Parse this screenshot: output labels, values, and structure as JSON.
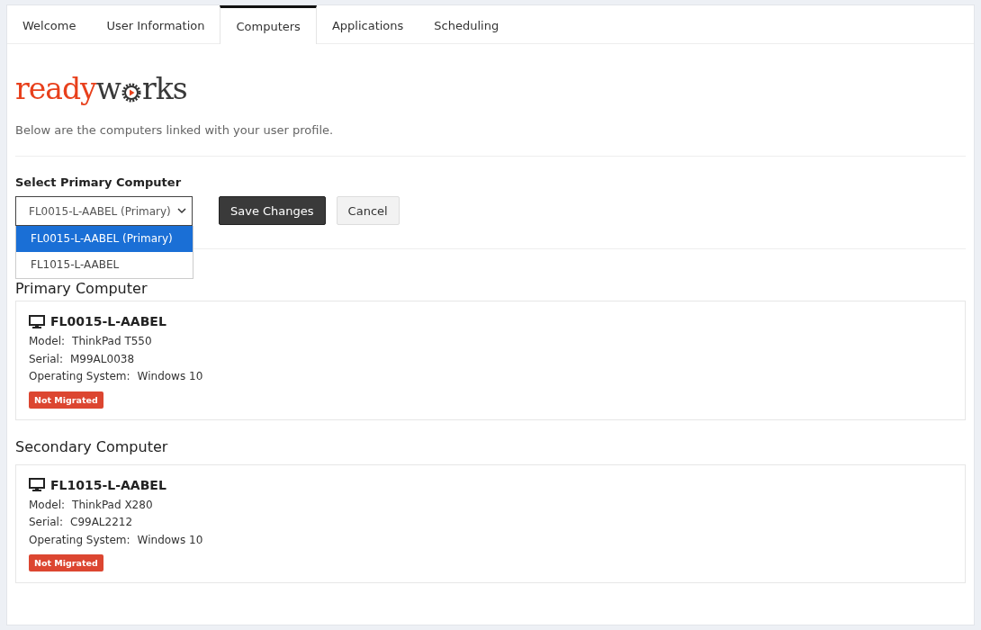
{
  "tabs": [
    {
      "label": "Welcome",
      "selected": false
    },
    {
      "label": "User Information",
      "selected": false
    },
    {
      "label": "Computers",
      "selected": true
    },
    {
      "label": "Applications",
      "selected": false
    },
    {
      "label": "Scheduling",
      "selected": false
    }
  ],
  "logo": {
    "part_1": "ready",
    "part_2": "w",
    "part_3": "rks"
  },
  "intro": "Below are the computers linked with your user profile.",
  "select": {
    "label": "Select Primary Computer",
    "value": "FL0015-L-AABEL (Primary)",
    "expanded": true,
    "options": [
      {
        "label": "FL0015-L-AABEL (Primary)",
        "selected": true
      },
      {
        "label": "FL1015-L-AABEL",
        "selected": false
      }
    ]
  },
  "buttons": [
    {
      "label": "Save Changes",
      "kind": "primary"
    },
    {
      "label": "Cancel",
      "kind": "secondary"
    }
  ],
  "sections": [
    {
      "title": "Primary Computer",
      "computer": {
        "name": "FL0015-L-AABEL",
        "fields": [
          {
            "label": "Model:",
            "value": "ThinkPad T550"
          },
          {
            "label": "Serial:",
            "value": "M99AL0038"
          },
          {
            "label": "Operating System:",
            "value": "Windows 10"
          }
        ],
        "status": "Not Migrated"
      }
    },
    {
      "title": "Secondary Computer",
      "computer": {
        "name": "FL1015-L-AABEL",
        "fields": [
          {
            "label": "Model:",
            "value": "ThinkPad X280"
          },
          {
            "label": "Serial:",
            "value": "C99AL2212"
          },
          {
            "label": "Operating System:",
            "value": "Windows 10"
          }
        ],
        "status": "Not Migrated"
      }
    }
  ]
}
